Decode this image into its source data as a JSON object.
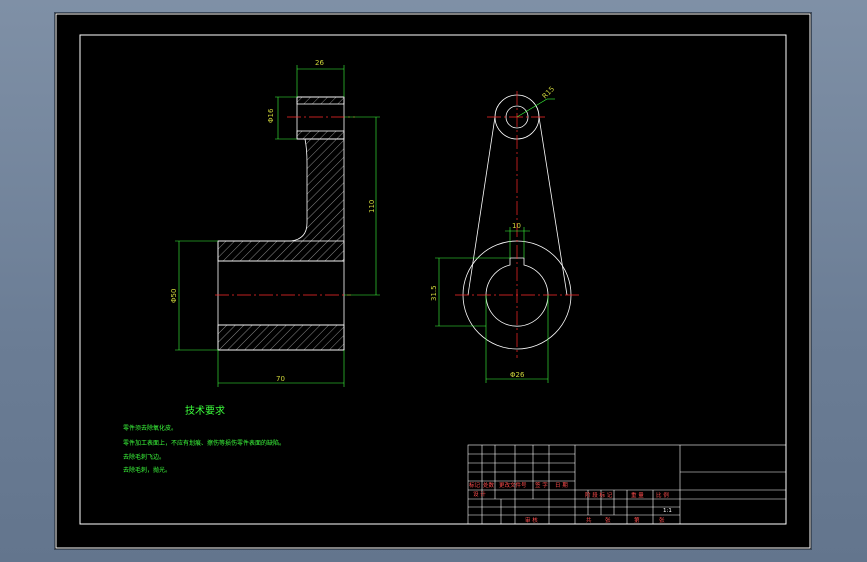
{
  "colors": {
    "background": "#000000",
    "outline": "#ffffff",
    "centerline": "#ff2a2a",
    "hatch": "#8a8a8a",
    "dimension": "#3cff3c",
    "dim_text": "#d9e04a",
    "notes": "#3cff3c",
    "title_block_text": "#ff4d4d"
  },
  "dimensions": {
    "top_width": "26",
    "top_dia": "Φ16",
    "height": "110",
    "hub_dia": "Φ50",
    "length": "70",
    "circle_r": "R15",
    "keyway": "10",
    "key_depth": "31.5",
    "bore": "Φ26"
  },
  "tech_requirements": {
    "title": "技术要求",
    "lines": [
      "零件须去除氧化皮。",
      "零件加工表面上，不应有划痕、擦伤等损伤零件表面的缺陷。",
      "去除毛刺飞边。",
      "去除毛刺，抛光。"
    ]
  },
  "title_block": {
    "labels": [
      "标记",
      "处数",
      "更改文件号",
      "签 字",
      "日 期"
    ],
    "design": "设 计",
    "stage": [
      "阶 段 标 记",
      "重 量",
      "比 例"
    ],
    "scale": "1:1",
    "review": "审 核",
    "sheets": [
      "共",
      "张",
      "第",
      "张"
    ]
  }
}
